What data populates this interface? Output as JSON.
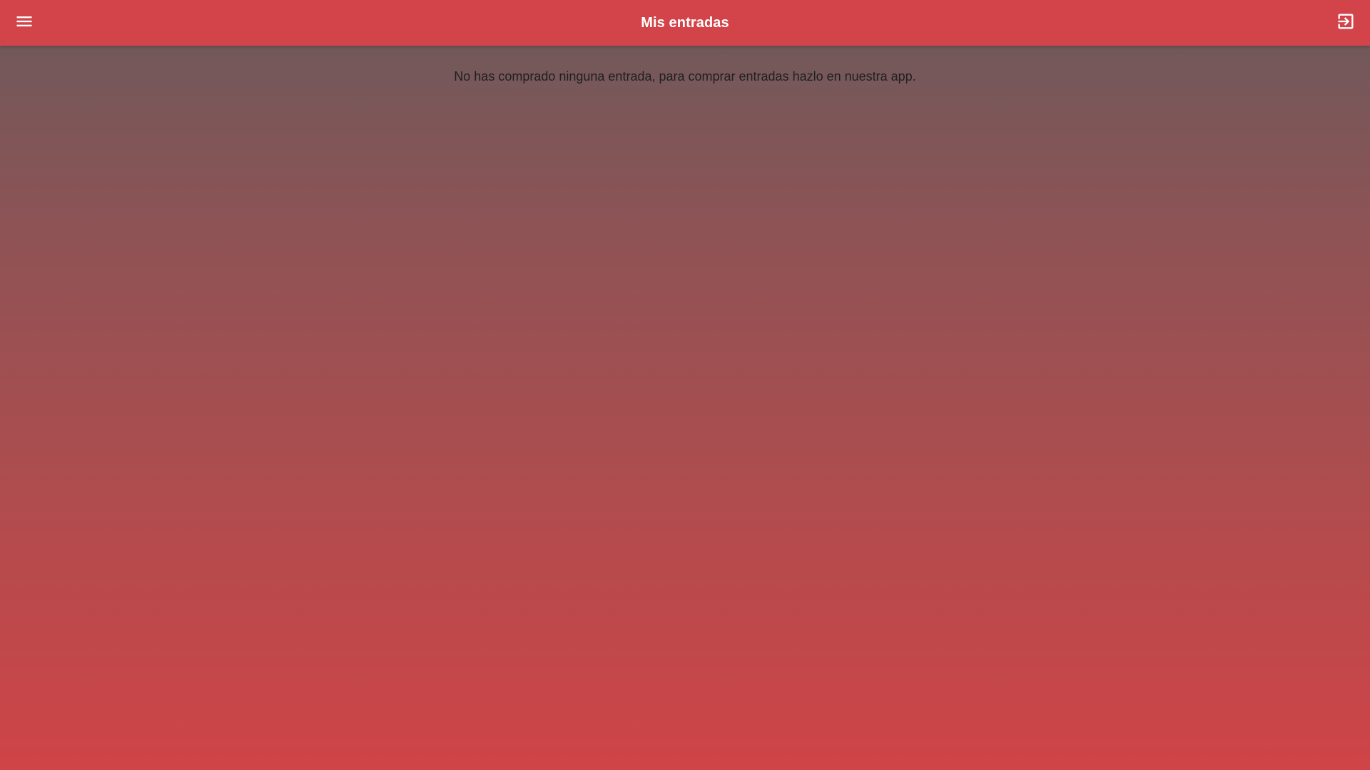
{
  "header": {
    "title": "Mis entradas",
    "menu_icon": "hamburger-menu-icon",
    "logout_icon": "exit-to-app-icon"
  },
  "main": {
    "empty_message": "No has comprado ninguna entrada, para comprar entradas hazlo en nuestra app."
  },
  "colors": {
    "toolbar": "#d2444a",
    "background_top": "#6b5a5c",
    "background_bottom": "#cf4447",
    "title_text": "#ffffff",
    "body_text": "#1f1f1f"
  }
}
